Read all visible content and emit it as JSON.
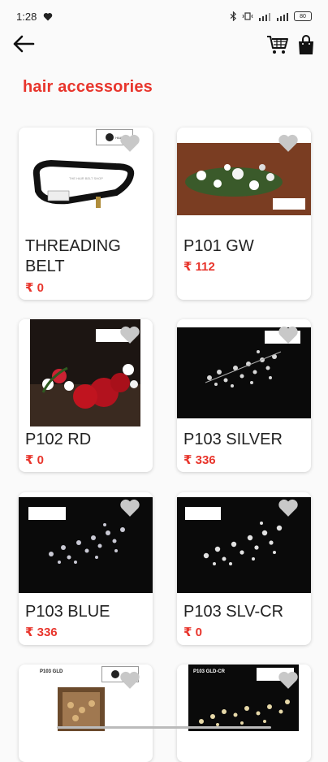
{
  "status_bar": {
    "time": "1:28",
    "battery": "80"
  },
  "header": {
    "back_icon": "arrow-left-icon",
    "cart_icon": "shopping-cart-icon",
    "bag_icon": "shopping-bag-icon"
  },
  "page": {
    "title": "hair accessories",
    "accent_color": "#e8352c"
  },
  "products": [
    {
      "name": "THREADING BELT",
      "price": "₹ 0"
    },
    {
      "name": "P101 GW",
      "price": "₹ 112"
    },
    {
      "name": "P102 RD",
      "price": "₹ 0"
    },
    {
      "name": "P103 SILVER",
      "price": "₹ 336"
    },
    {
      "name": "P103 BLUE",
      "price": "₹ 336"
    },
    {
      "name": "P103 SLV-CR",
      "price": "₹ 0"
    },
    {
      "name": "",
      "price": "",
      "image_label": "P103 GLD"
    },
    {
      "name": "",
      "price": "",
      "image_label": "P103 GLD-CR"
    }
  ]
}
